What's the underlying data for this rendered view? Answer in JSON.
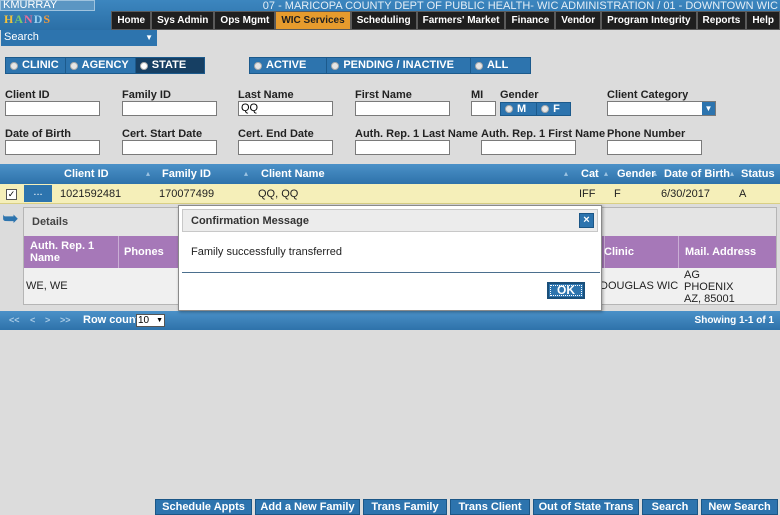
{
  "header": {
    "username": "KMURRAY",
    "logo_letters": [
      "H",
      "A",
      "N",
      "D",
      "S"
    ],
    "agency": "07 - MARICOPA COUNTY DEPT OF PUBLIC HEALTH- WIC ADMINISTRATION / 01 - DOWNTOWN WIC",
    "nav": [
      "Home",
      "Sys Admin",
      "Ops Mgmt",
      "WIC Services",
      "Scheduling",
      "Farmers' Market",
      "Finance",
      "Vendor",
      "Program Integrity",
      "Reports",
      "Help"
    ],
    "active_nav": "WIC Services"
  },
  "search_dropdown": {
    "value": "Search"
  },
  "scope_toggle": {
    "options": [
      "CLINIC",
      "AGENCY",
      "STATE"
    ],
    "selected": "STATE"
  },
  "status_toggle": {
    "options": [
      "ACTIVE",
      "PENDING / INACTIVE",
      "ALL"
    ]
  },
  "form": {
    "client_id": {
      "label": "Client ID",
      "value": ""
    },
    "family_id": {
      "label": "Family ID",
      "value": ""
    },
    "last_name": {
      "label": "Last Name",
      "value": "QQ"
    },
    "first_name": {
      "label": "First Name",
      "value": ""
    },
    "mi": {
      "label": "MI",
      "value": ""
    },
    "gender": {
      "label": "Gender",
      "options": [
        "M",
        "F"
      ]
    },
    "client_category": {
      "label": "Client Category",
      "value": ""
    },
    "dob": {
      "label": "Date of Birth",
      "value": ""
    },
    "cert_start": {
      "label": "Cert. Start Date",
      "value": ""
    },
    "cert_end": {
      "label": "Cert. End Date",
      "value": ""
    },
    "auth_rep_last": {
      "label": "Auth. Rep. 1 Last Name",
      "value": ""
    },
    "auth_rep_first": {
      "label": "Auth. Rep. 1 First Name",
      "value": ""
    },
    "phone": {
      "label": "Phone Number",
      "value": ""
    }
  },
  "grid": {
    "headers": [
      "Client ID",
      "Family ID",
      "Client Name",
      "Cat",
      "Gender",
      "Date of Birth",
      "Status"
    ],
    "expand_label": "...",
    "check_glyph": "✓",
    "rows": [
      {
        "client_id": "1021592481",
        "family_id": "170077499",
        "client_name": "QQ, QQ",
        "cat": "IFF",
        "gender": "F",
        "dob": "6/30/2017",
        "status": "A"
      }
    ],
    "details": {
      "title": "Details",
      "headers": [
        "Auth. Rep. 1 Name",
        "Phones",
        "Clinic",
        "Mail. Address"
      ],
      "row": {
        "auth_rep": "WE, WE",
        "clinic": "DOUGLAS WIC",
        "address_line1": "AG",
        "address_line2": "PHOENIX",
        "address_line3": "AZ, 85001"
      }
    },
    "footer": {
      "pager": [
        "<<",
        "<",
        ">",
        ">>"
      ],
      "row_count_label": "Row count:",
      "row_count_value": "10",
      "showing": "Showing 1-1 of 1"
    }
  },
  "modal": {
    "title": "Confirmation Message",
    "close_glyph": "×",
    "message": "Family successfully transferred",
    "ok_label": "OK"
  },
  "bottom_actions": [
    "Schedule Appts",
    "Add a New Family",
    "Trans Family",
    "Trans Client",
    "Out of State Trans",
    "Search",
    "New Search"
  ],
  "colors": {
    "accent": "#2d74ae",
    "active_nav": "#e69b2d",
    "details_header": "#a678b8",
    "selected_row": "#f5efb9"
  }
}
